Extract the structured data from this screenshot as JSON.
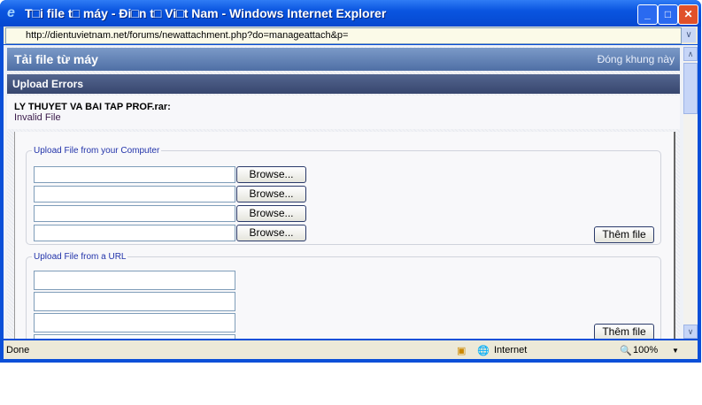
{
  "window": {
    "title": "T□i file t□ máy - Đi□n t□ Vi□t Nam - Windows Internet Explorer",
    "url": "http://dientuvietnam.net/forums/newattachment.php?do=manageattach&p="
  },
  "header": {
    "title": "Tải file từ máy",
    "close_link": "Đóng khung này"
  },
  "errors": {
    "heading": "Upload Errors",
    "file": "LY THUYET VA BAI TAP PROF.rar:",
    "message": "Invalid File"
  },
  "computer_upload": {
    "legend": "Upload File from your Computer",
    "browse_label": "Browse...",
    "add_label": "Thêm file"
  },
  "url_upload": {
    "legend": "Upload File from a URL",
    "add_label": "Thêm file"
  },
  "status": {
    "text": "Done",
    "zone": "Internet",
    "zoom": "100%"
  }
}
